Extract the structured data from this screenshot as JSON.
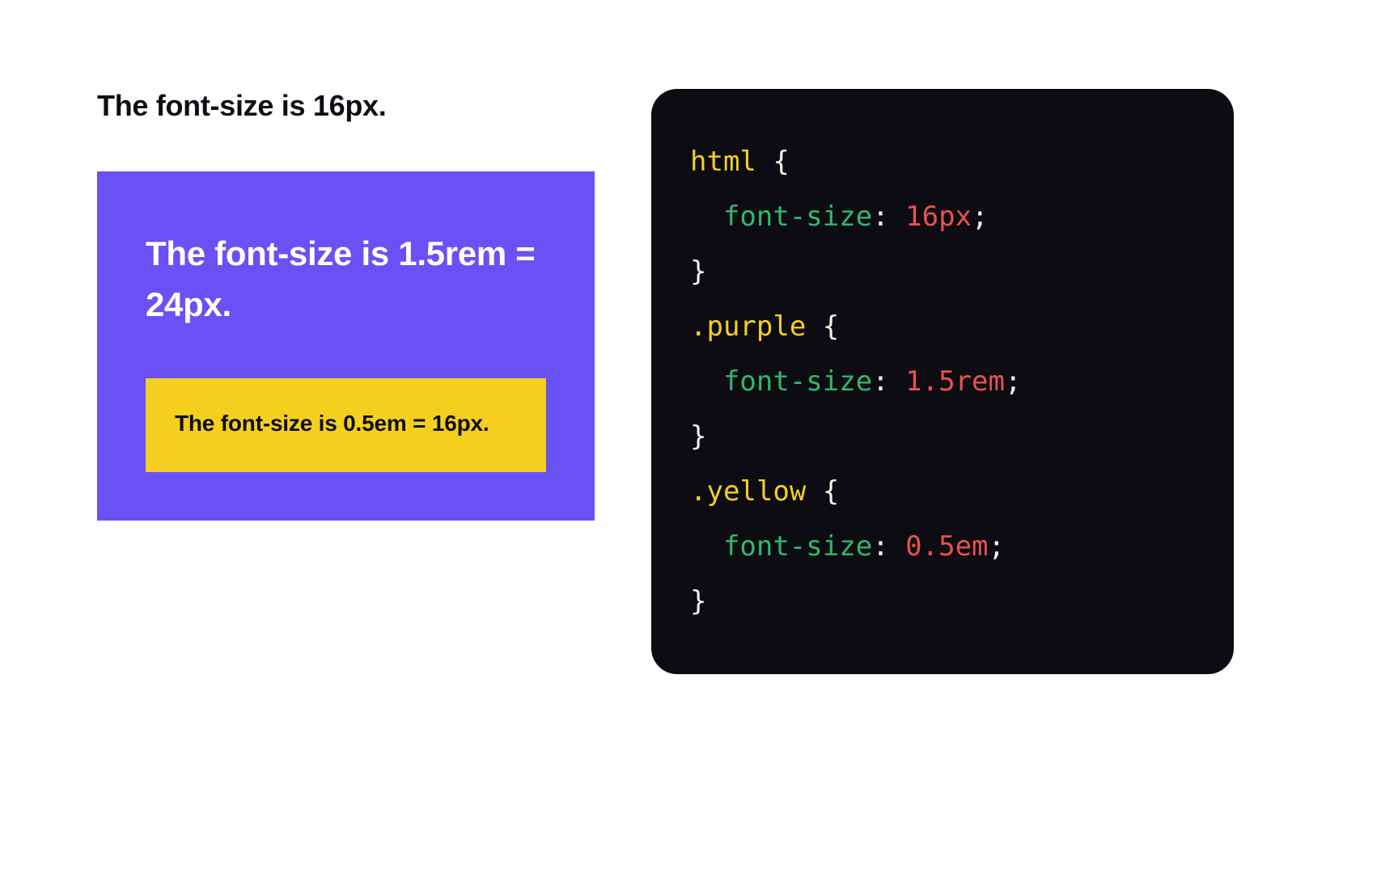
{
  "demo": {
    "base_text": "The font-size is 16px.",
    "purple_text": "The font-size is 1.5rem = 24px.",
    "yellow_text": "The font-size is 0.5em = 16px."
  },
  "code": {
    "rule1_selector": "html",
    "rule1_property": "font-size",
    "rule1_value": "16px",
    "rule2_selector": ".purple",
    "rule2_property": "font-size",
    "rule2_value": "1.5rem",
    "rule3_selector": ".yellow",
    "rule3_property": "font-size",
    "rule3_value": "0.5em",
    "brace_open": " {",
    "brace_close": "}",
    "colon": ":",
    "semicolon": ";",
    "indent": "  ",
    "space": " "
  }
}
